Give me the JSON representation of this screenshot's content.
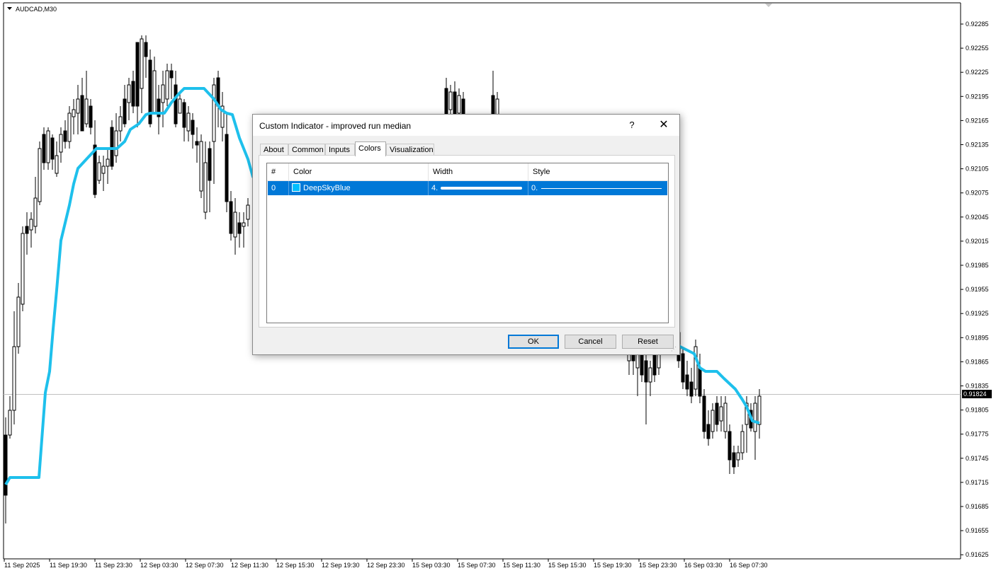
{
  "chart": {
    "symbol_label": "AUDCAD,M30",
    "current_price": "0.91824",
    "price_labels": [
      "0.92285",
      "0.92255",
      "0.92225",
      "0.92195",
      "0.92165",
      "0.92135",
      "0.92105",
      "0.92075",
      "0.92045",
      "0.92015",
      "0.91985",
      "0.91955",
      "0.91925",
      "0.91895",
      "0.91865",
      "0.91835",
      "0.91805",
      "0.91775",
      "0.91745",
      "0.91715",
      "0.91685",
      "0.91655",
      "0.91625"
    ],
    "time_labels": [
      "11 Sep 2025",
      "11 Sep 19:30",
      "11 Sep 23:30",
      "12 Sep 03:30",
      "12 Sep 07:30",
      "12 Sep 11:30",
      "12 Sep 15:30",
      "12 Sep 19:30",
      "12 Sep 23:30",
      "15 Sep 03:30",
      "15 Sep 07:30",
      "15 Sep 11:30",
      "15 Sep 15:30",
      "15 Sep 19:30",
      "15 Sep 23:30",
      "16 Sep 03:30",
      "16 Sep 07:30"
    ],
    "indicator_color": "#1ec0ec",
    "bear_color": "#000000",
    "bull_color": "#ffffff"
  },
  "dialog": {
    "title": "Custom Indicator - improved run median",
    "help_label": "?",
    "close_label": "✕",
    "tabs": [
      {
        "label": "About"
      },
      {
        "label": "Common"
      },
      {
        "label": "Inputs"
      },
      {
        "label": "Colors"
      },
      {
        "label": "Visualization"
      }
    ],
    "active_tab": "Colors",
    "grid": {
      "headers": [
        "#",
        "Color",
        "Width",
        "Style"
      ],
      "rows": [
        {
          "index": "0",
          "color_name": "DeepSkyBlue",
          "color_hex": "#00bfff",
          "width": "4.",
          "style": "0."
        }
      ]
    },
    "buttons": {
      "ok": "OK",
      "cancel": "Cancel",
      "reset": "Reset"
    }
  }
}
